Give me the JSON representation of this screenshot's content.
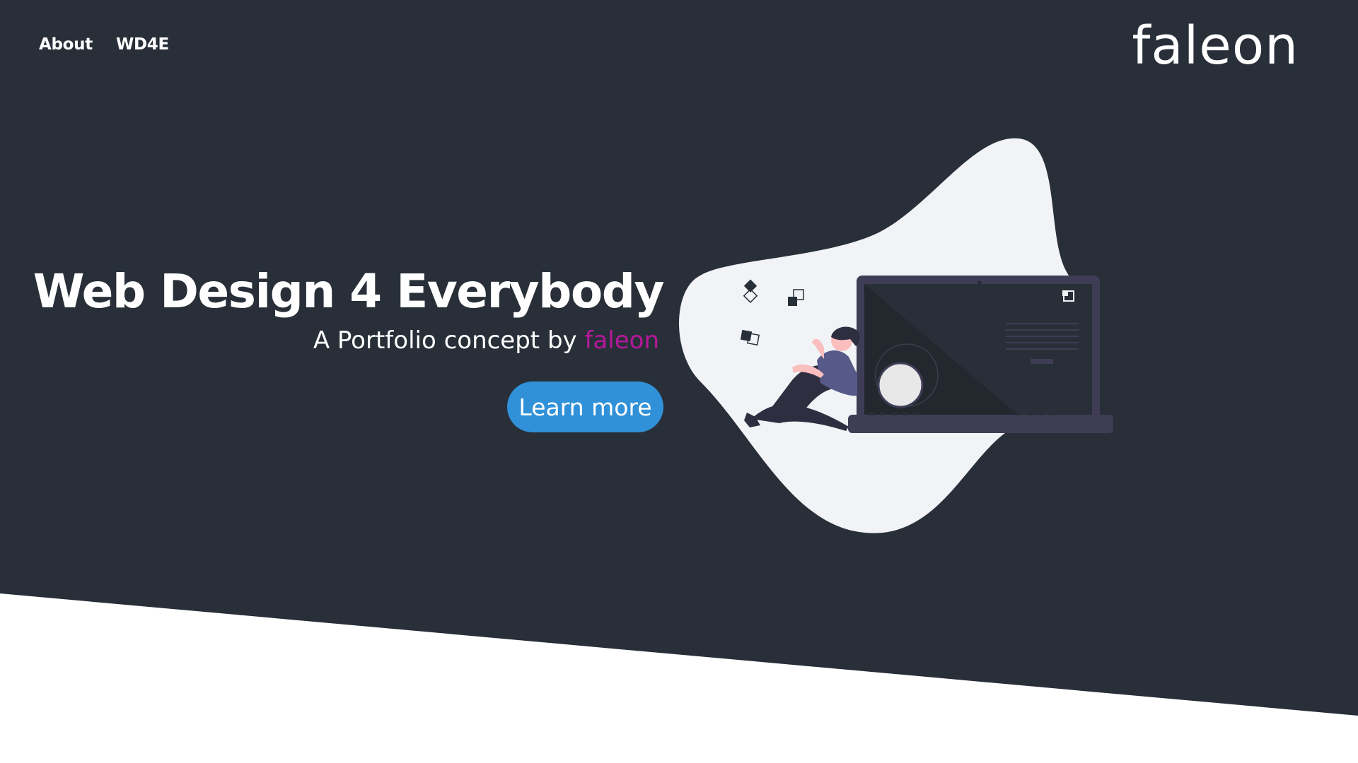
{
  "nav": {
    "items": [
      {
        "label": "About"
      },
      {
        "label": "WD4E"
      }
    ]
  },
  "brand": {
    "logo_text": "faleon"
  },
  "hero": {
    "title": "Web Design 4 Everybody",
    "subtitle_prefix": "A Portfolio concept by",
    "subtitle_accent": "faleon",
    "cta_label": "Learn more"
  },
  "colors": {
    "background": "#282f38",
    "accent": "#b5189a",
    "button": "#3091d8",
    "blob": "#f2f3f7",
    "laptop": "#3f3d56"
  },
  "icons": [
    "laptop-illustration",
    "person-illustration"
  ]
}
